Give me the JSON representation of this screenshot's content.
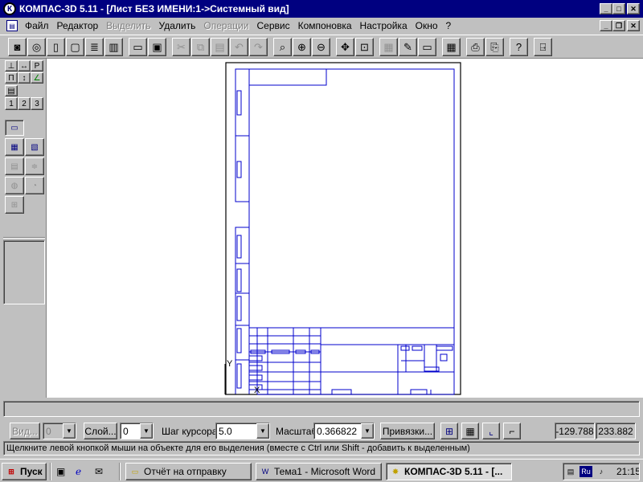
{
  "window": {
    "title": "КОМПАС-3D 5.11 - [Лист БЕЗ ИМЕНИ:1->Системный вид]",
    "app_icon": "kompas-logo-icon"
  },
  "menu": {
    "items": [
      {
        "label": "Файл",
        "enabled": true
      },
      {
        "label": "Редактор",
        "enabled": true
      },
      {
        "label": "Выделить",
        "enabled": false
      },
      {
        "label": "Удалить",
        "enabled": true
      },
      {
        "label": "Операции",
        "enabled": false
      },
      {
        "label": "Сервис",
        "enabled": true
      },
      {
        "label": "Компоновка",
        "enabled": true
      },
      {
        "label": "Настройка",
        "enabled": true
      },
      {
        "label": "Окно",
        "enabled": true
      },
      {
        "label": "?",
        "enabled": true
      }
    ]
  },
  "toolbar": {
    "buttons": [
      {
        "icon": "camera-icon",
        "enabled": true
      },
      {
        "icon": "camera-settings-icon",
        "enabled": true
      },
      {
        "icon": "new-sheet-icon",
        "enabled": true
      },
      {
        "icon": "new-document-icon",
        "enabled": true
      },
      {
        "icon": "new-text-document-icon",
        "enabled": true
      },
      {
        "icon": "new-specification-icon",
        "enabled": true
      },
      {
        "icon": "open-folder-icon",
        "enabled": true
      },
      {
        "icon": "save-icon",
        "enabled": true
      },
      {
        "icon": "cut-icon",
        "enabled": false
      },
      {
        "icon": "copy-icon",
        "enabled": false
      },
      {
        "icon": "paste-icon",
        "enabled": false
      },
      {
        "icon": "undo-icon",
        "enabled": false
      },
      {
        "icon": "redo-icon",
        "enabled": false
      },
      {
        "icon": "zoom-icon",
        "enabled": true
      },
      {
        "icon": "zoom-in-icon",
        "enabled": true
      },
      {
        "icon": "zoom-out-icon",
        "enabled": true
      },
      {
        "icon": "pan-icon",
        "enabled": true
      },
      {
        "icon": "zoom-fit-icon",
        "enabled": true
      },
      {
        "icon": "layers-icon",
        "enabled": false
      },
      {
        "icon": "edit-pen-icon",
        "enabled": true
      },
      {
        "icon": "window-icon",
        "enabled": true
      },
      {
        "icon": "calculator-icon",
        "enabled": true
      },
      {
        "icon": "print-preview-icon",
        "enabled": true
      },
      {
        "icon": "print-icon",
        "enabled": true
      },
      {
        "icon": "context-help-icon",
        "enabled": true
      },
      {
        "icon": "exit-door-icon",
        "enabled": true
      }
    ]
  },
  "left_panel": {
    "tab_labels": [
      "1",
      "2",
      "3"
    ]
  },
  "status": {
    "view_label": "Вид...",
    "view_value": "0",
    "layer_label": "Слой...",
    "layer_value": "0",
    "cursor_step_label": "Шаг курсора",
    "cursor_step_value": "5.0",
    "scale_label": "Масштаб",
    "scale_value": "0.366822",
    "snap_label": "Привязки...",
    "coord_x": "-129.788",
    "coord_y": "233.882",
    "hint": "Щелкните левой кнопкой мыши на объекте для его выделения (вместе с Ctrl или Shift - добавить к выделенным)"
  },
  "taskbar": {
    "start_label": "Пуск",
    "items": [
      {
        "label": "Отчёт на отправку",
        "icon": "folder-icon"
      },
      {
        "label": "Тема1 - Microsoft Word",
        "icon": "word-icon"
      },
      {
        "label": "КОМПАС-3D 5.11 - [...",
        "icon": "kompas-icon"
      }
    ],
    "tray_lang": "Ru",
    "clock": "21:15"
  },
  "colors": {
    "titlebar": "#000080",
    "drawing_lines": "#0000cc",
    "canvas": "#ffffff"
  }
}
